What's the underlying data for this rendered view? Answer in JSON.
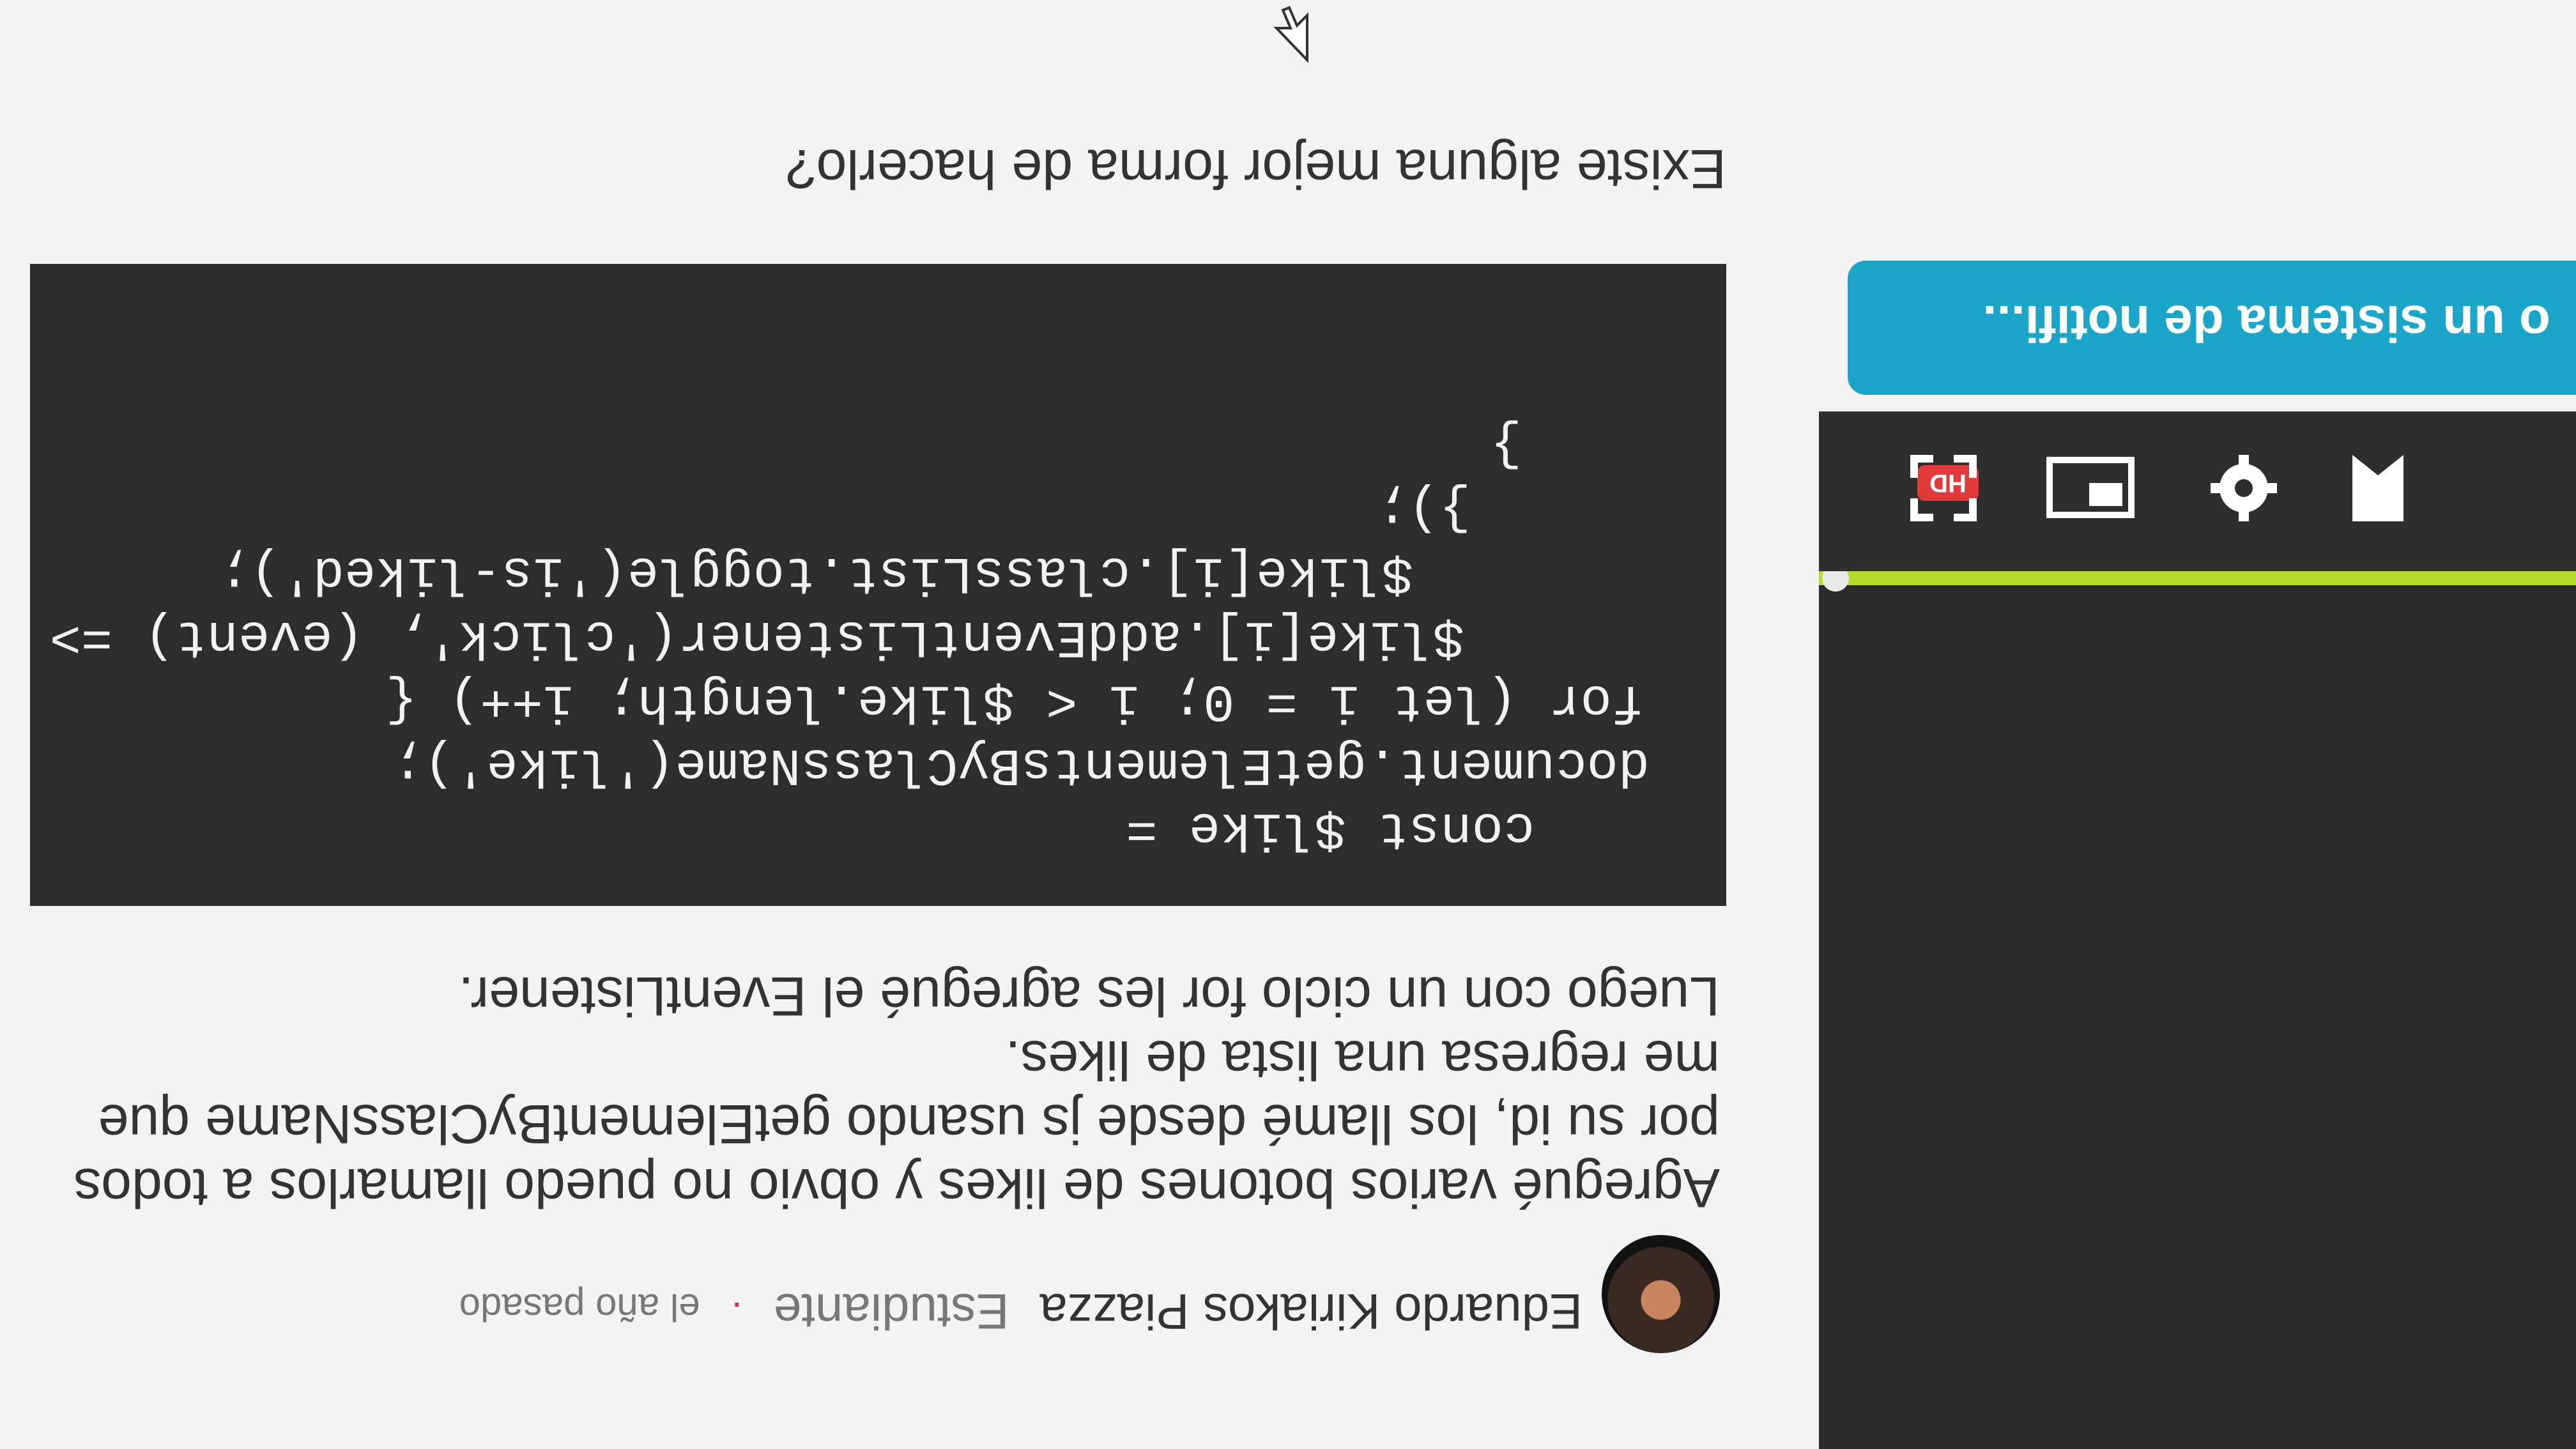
{
  "player": {
    "hd_label": "HD",
    "next_chip_text": "o un sistema de notifi..."
  },
  "comment": {
    "author_name": "Eduardo Kiriakos Piazza",
    "author_role": "Estudiante",
    "separator": "·",
    "time_ago": "el año pasado",
    "paragraph_lines": [
      "Agregué varios botones de likes y obvio no puedo llamarlos a todos",
      "por su id, los llamé desde js usando getElementByClassName que",
      "me regresa una lista de likes.",
      "Luego con un ciclo for les agregué el EventListener."
    ],
    "code_lines": [
      "const $like =",
      "document.getElementsByClassName('like');",
      "for (let i = 0; i < $like.length; i++) {",
      "$like[i].addEventListener('click', (event) => {",
      "$like[i].classList.toggle('is-liked');",
      "});",
      "}"
    ],
    "question": "Existe alguna mejor forma de hacerlo?"
  },
  "colors": {
    "progress": "#b5dc2a",
    "chip": "#1aa5c9",
    "code_bg": "#2d2d2d",
    "keyword": "#ff3b30",
    "string": "#a8e048"
  }
}
